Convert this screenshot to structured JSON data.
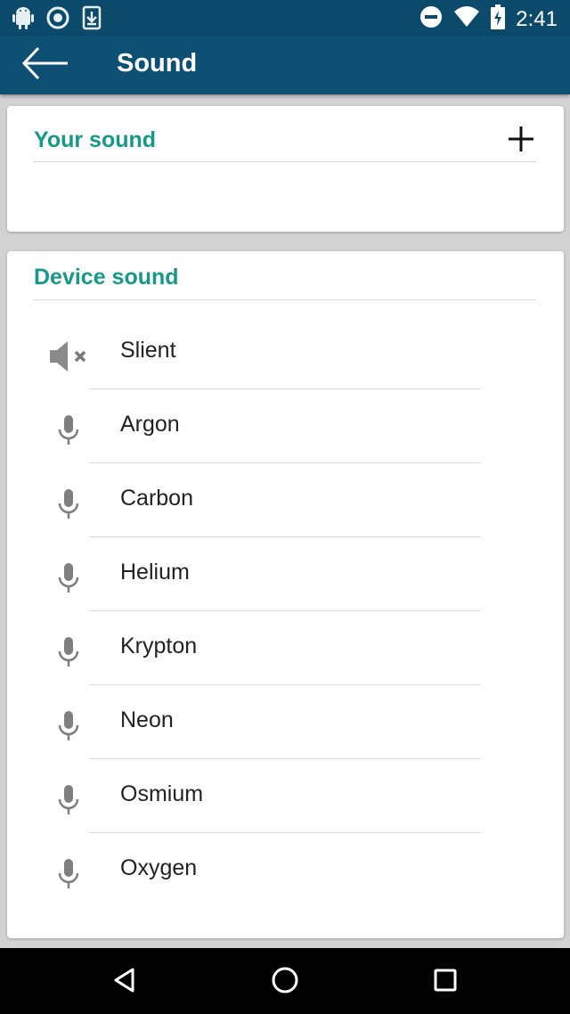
{
  "status_bar": {
    "time": "2:41",
    "left_icons": [
      "android-debug-icon",
      "sync-circle-icon",
      "download-icon"
    ],
    "right_icons": [
      "do-not-disturb-icon",
      "wifi-icon",
      "battery-charging-icon"
    ]
  },
  "app_bar": {
    "title": "Sound",
    "back_icon": "arrow-back-icon"
  },
  "your_sound": {
    "title": "Your sound",
    "add_icon": "plus-icon"
  },
  "device_sound": {
    "title": "Device sound",
    "items": [
      {
        "label": "Slient",
        "icon": "volume-off-icon"
      },
      {
        "label": "Argon",
        "icon": "microphone-icon"
      },
      {
        "label": "Carbon",
        "icon": "microphone-icon"
      },
      {
        "label": "Helium",
        "icon": "microphone-icon"
      },
      {
        "label": "Krypton",
        "icon": "microphone-icon"
      },
      {
        "label": "Neon",
        "icon": "microphone-icon"
      },
      {
        "label": "Osmium",
        "icon": "microphone-icon"
      },
      {
        "label": "Oxygen",
        "icon": "microphone-icon"
      }
    ]
  },
  "nav_bar": {
    "buttons": [
      "back-triangle-icon",
      "home-circle-icon",
      "recents-square-icon"
    ]
  },
  "colors": {
    "status_bar": "#0c4a6b",
    "app_bar": "#0e5074",
    "accent": "#17998a",
    "background": "#d2d2d2"
  }
}
